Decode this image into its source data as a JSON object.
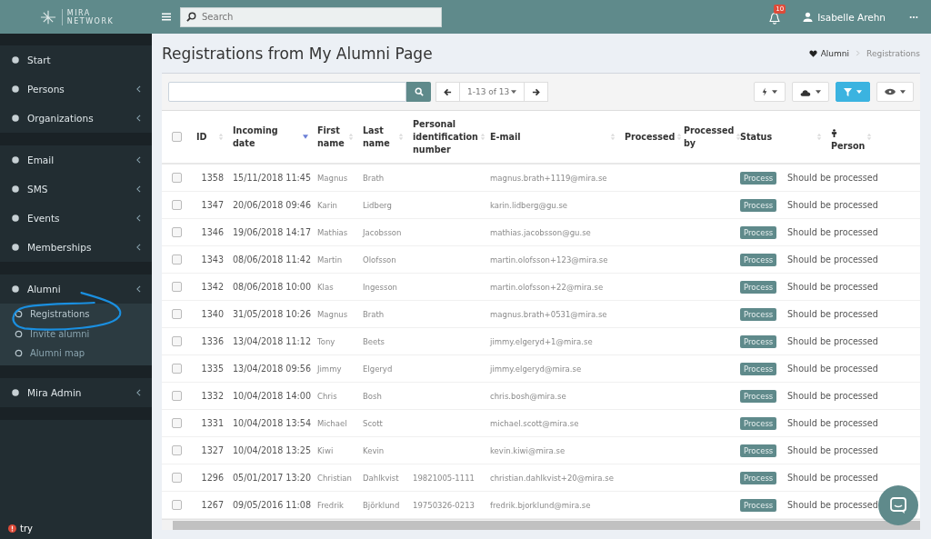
{
  "brand": {
    "line_1": "MIRA",
    "line_2": "NETWORK"
  },
  "header": {
    "search": {
      "placeholder": "Search"
    },
    "notifications": "10",
    "user": "Isabelle Arehn"
  },
  "sidebar": {
    "groups": [
      [
        {
          "label": "Start"
        },
        {
          "label": "Persons",
          "expanded": false
        },
        {
          "label": "Organizations",
          "expanded": false
        }
      ],
      [
        {
          "label": "Email",
          "expanded": false
        },
        {
          "label": "SMS",
          "expanded": false
        },
        {
          "label": "Events",
          "expanded": false
        },
        {
          "label": "Memberships",
          "expanded": false
        }
      ],
      [
        {
          "label": "Alumni",
          "expanded": true,
          "children": [
            {
              "label": "Registrations",
              "selected": true
            },
            {
              "label": "Invite alumni",
              "selected": false
            },
            {
              "label": "Alumni map",
              "selected": false
            }
          ]
        }
      ],
      [
        {
          "label": "Mira Admin",
          "expanded": false
        }
      ]
    ],
    "footer": "try"
  },
  "page": {
    "title": "Registrations from My Alumni Page",
    "breadcrumb": [
      "Alumni",
      "Registrations"
    ]
  },
  "toolbar": {
    "pager": "1-13 of 13",
    "actions": [
      {
        "selected": false
      },
      {
        "selected": false
      },
      {
        "selected": true
      },
      {
        "selected": false
      }
    ]
  },
  "table": {
    "select_all": {
      "checked": false
    },
    "columns": [
      {
        "label": "ID",
        "sorted": false
      },
      {
        "label": "Incoming date",
        "sorted": true
      },
      {
        "label": "First name",
        "sorted": false
      },
      {
        "label": "Last name",
        "sorted": false
      },
      {
        "label": "Personal identification number",
        "sorted": false
      },
      {
        "label": "E-mail",
        "sorted": false
      },
      {
        "label": "Processed",
        "sorted": false
      },
      {
        "label": "Processed by",
        "sorted": false
      },
      {
        "label": "Status",
        "sorted": false
      },
      {
        "label": "Person",
        "sorted": false
      }
    ],
    "rows": [
      {
        "checked": false,
        "id": "1358",
        "date": "15/11/2018 11:45",
        "first": "Magnus",
        "last": "Brath",
        "pin": "",
        "email": "magnus.brath+1119@mira.se",
        "action": "Process",
        "status": "Should be processed"
      },
      {
        "checked": false,
        "id": "1347",
        "date": "20/06/2018 09:46",
        "first": "Karin",
        "last": "Lidberg",
        "pin": "",
        "email": "karin.lidberg@gu.se",
        "action": "Process",
        "status": "Should be processed"
      },
      {
        "checked": false,
        "id": "1346",
        "date": "19/06/2018 14:17",
        "first": "Mathias",
        "last": "Jacobsson",
        "pin": "",
        "email": "mathias.jacobsson@gu.se",
        "action": "Process",
        "status": "Should be processed"
      },
      {
        "checked": false,
        "id": "1343",
        "date": "08/06/2018 11:42",
        "first": "Martin",
        "last": "Olofsson",
        "pin": "",
        "email": "martin.olofsson+123@mira.se",
        "action": "Process",
        "status": "Should be processed"
      },
      {
        "checked": false,
        "id": "1342",
        "date": "08/06/2018 10:00",
        "first": "Klas",
        "last": "Ingesson",
        "pin": "",
        "email": "martin.olofsson+22@mira.se",
        "action": "Process",
        "status": "Should be processed"
      },
      {
        "checked": false,
        "id": "1340",
        "date": "31/05/2018 10:26",
        "first": "Magnus",
        "last": "Brath",
        "pin": "",
        "email": "magnus.brath+0531@mira.se",
        "action": "Process",
        "status": "Should be processed"
      },
      {
        "checked": false,
        "id": "1336",
        "date": "13/04/2018 11:12",
        "first": "Tony",
        "last": "Beets",
        "pin": "",
        "email": "jimmy.elgeryd+1@mira.se",
        "action": "Process",
        "status": "Should be processed"
      },
      {
        "checked": false,
        "id": "1335",
        "date": "13/04/2018 09:56",
        "first": "Jimmy",
        "last": "Elgeryd",
        "pin": "",
        "email": "jimmy.elgeryd@mira.se",
        "action": "Process",
        "status": "Should be processed"
      },
      {
        "checked": false,
        "id": "1332",
        "date": "10/04/2018 14:00",
        "first": "Chris",
        "last": "Bosh",
        "pin": "",
        "email": "chris.bosh@mira.se",
        "action": "Process",
        "status": "Should be processed"
      },
      {
        "checked": false,
        "id": "1331",
        "date": "10/04/2018 13:54",
        "first": "Michael",
        "last": "Scott",
        "pin": "",
        "email": "michael.scott@mira.se",
        "action": "Process",
        "status": "Should be processed"
      },
      {
        "checked": false,
        "id": "1327",
        "date": "10/04/2018 13:25",
        "first": "Kiwi",
        "last": "Kevin",
        "pin": "",
        "email": "kevin.kiwi@mira.se",
        "action": "Process",
        "status": "Should be processed"
      },
      {
        "checked": false,
        "id": "1296",
        "date": "05/01/2017 13:20",
        "first": "Christian",
        "last": "Dahlkvist",
        "pin": "19821005-1111",
        "email": "christian.dahlkvist+20@mira.se",
        "action": "Process",
        "status": "Should be processed"
      },
      {
        "checked": false,
        "id": "1267",
        "date": "09/05/2016 11:08",
        "first": "Fredrik",
        "last": "Björklund",
        "pin": "19750326-0213",
        "email": "fredrik.bjorklund@mira.se",
        "action": "Process",
        "status": "Should be processed"
      }
    ]
  }
}
